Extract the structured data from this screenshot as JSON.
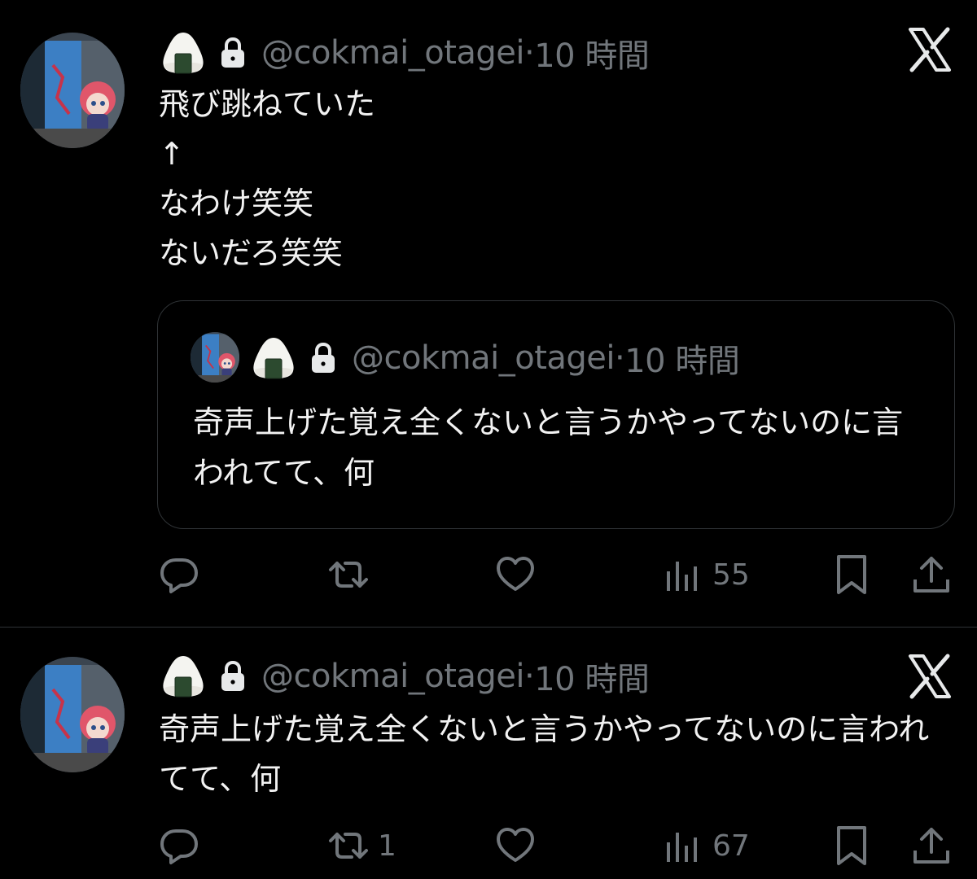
{
  "tweets": [
    {
      "handle": "@cokmai_otagei",
      "separator": "·",
      "time": "10 時間",
      "text": "飛び跳ねていた\n↑\nなわけ笑笑\nないだろ笑笑",
      "quote": {
        "handle": "@cokmai_otagei",
        "separator": "·",
        "time": "10 時間",
        "text": "奇声上げた覚え全くないと言うかやってないのに言われてて、何"
      },
      "actions": {
        "reply": "",
        "retweet": "",
        "like": "",
        "views": "55"
      }
    },
    {
      "handle": "@cokmai_otagei",
      "separator": "·",
      "time": "10 時間",
      "text": "奇声上げた覚え全くないと言うかやってないのに言われてて、何",
      "actions": {
        "reply": "",
        "retweet": "1",
        "like": "",
        "views": "67"
      }
    }
  ],
  "colors": {
    "background": "#000000",
    "text": "#e7e9ea",
    "muted": "#71767b",
    "border": "#2f3336"
  },
  "icons": [
    "onigiri-icon",
    "lock-icon",
    "x-logo-icon",
    "reply-icon",
    "retweet-icon",
    "like-icon",
    "views-icon",
    "bookmark-icon",
    "share-icon"
  ]
}
